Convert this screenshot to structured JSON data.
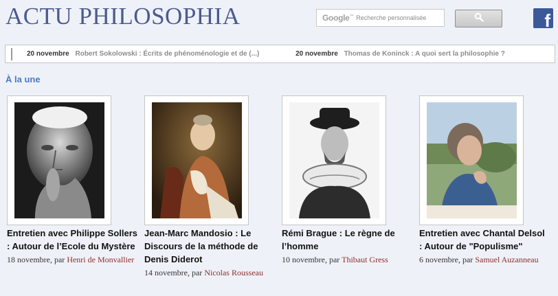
{
  "site": {
    "title": "ACTU PHILOSOPHIA"
  },
  "search": {
    "brand": "Google",
    "placeholder": "Recherche personnalisée"
  },
  "social": {
    "facebook_letter": "f"
  },
  "ticker": {
    "items": [
      {
        "date": "20 novembre",
        "title": "Robert Sokolowski : Écrits de phénoménologie et de (...)"
      },
      {
        "date": "20 novembre",
        "title": "Thomas de Koninck : A quoi sert la philosophie ?"
      }
    ]
  },
  "section": {
    "label": "À la une"
  },
  "articles": [
    {
      "title": "Entretien avec Philippe Sollers : Autour de l’Ecole du Mystère",
      "date": "18 novembre, par",
      "author": "Henri de Monvallier",
      "photo": "portrait-photo"
    },
    {
      "title": "Jean-Marc Mandosio : Le Discours de la méthode de Denis Diderot",
      "date": "14 novembre, par",
      "author": "Nicolas Rousseau",
      "photo": "painting-portrait"
    },
    {
      "title": "Rémi Brague : Le règne de l’homme",
      "date": "10 novembre, par",
      "author": "Thibaut Gress",
      "photo": "engraving-portrait"
    },
    {
      "title": "Entretien avec Chantal Delsol : Autour de \"Populisme\"",
      "date": "6 novembre, par",
      "author": "Samuel Auzanneau",
      "photo": "outdoor-photo"
    }
  ],
  "colors": {
    "accent": "#4e77c4",
    "title": "#4d5a8f",
    "author": "#8e2c2c",
    "facebook": "#3b5998"
  }
}
